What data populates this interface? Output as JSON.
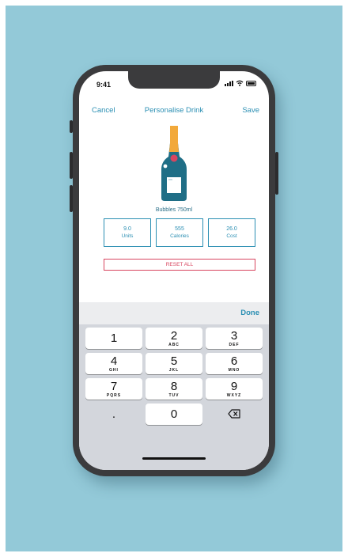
{
  "status": {
    "time": "9:41"
  },
  "nav": {
    "cancel": "Cancel",
    "title": "Personalise Drink",
    "save": "Save"
  },
  "drink": {
    "name": "Bubbles 750ml",
    "icon": "champagne-bottle-icon"
  },
  "stats": [
    {
      "value": "9.0",
      "label": "Units"
    },
    {
      "value": "555",
      "label": "Calories"
    },
    {
      "value": "26.0",
      "label": "Cost"
    }
  ],
  "reset_label": "RESET ALL",
  "keyboard": {
    "done": "Done",
    "keys": [
      {
        "digit": "1",
        "letters": ""
      },
      {
        "digit": "2",
        "letters": "ABC"
      },
      {
        "digit": "3",
        "letters": "DEF"
      },
      {
        "digit": "4",
        "letters": "GHI"
      },
      {
        "digit": "5",
        "letters": "JKL"
      },
      {
        "digit": "6",
        "letters": "MNO"
      },
      {
        "digit": "7",
        "letters": "PQRS"
      },
      {
        "digit": "8",
        "letters": "TUV"
      },
      {
        "digit": "9",
        "letters": "WXYZ"
      },
      {
        "digit": ".",
        "letters": ""
      },
      {
        "digit": "0",
        "letters": ""
      }
    ]
  },
  "colors": {
    "accent": "#2b8fb3",
    "reset": "#d8455f",
    "background": "#93c9d8",
    "bottle": "#1f6e86",
    "foil": "#f2a93b"
  }
}
